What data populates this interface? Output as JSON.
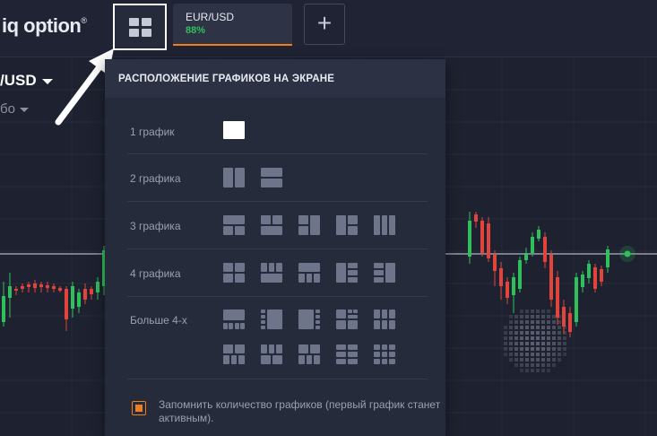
{
  "header": {
    "logo": "iq option",
    "logo_mark": "®",
    "asset_tab": {
      "name": "EUR/USD",
      "payout": "88%"
    },
    "add_tab_label": "+"
  },
  "chart": {
    "asset_label": "/USD",
    "sub_label": "бо"
  },
  "layout_panel": {
    "title": "РАСПОЛОЖЕНИЕ ГРАФИКОВ НА ЭКРАНЕ",
    "rows": [
      {
        "label": "1 график"
      },
      {
        "label": "2 графика"
      },
      {
        "label": "3 графика"
      },
      {
        "label": "4 графика"
      },
      {
        "label": "Больше 4-х"
      }
    ],
    "remember_label": "Запомнить количество графиков (первый график станет активным).",
    "remember_checked": true
  },
  "colors": {
    "accent": "#f07e1c",
    "up": "#2fc05c",
    "down": "#e0443a",
    "background": "#1e2230"
  }
}
